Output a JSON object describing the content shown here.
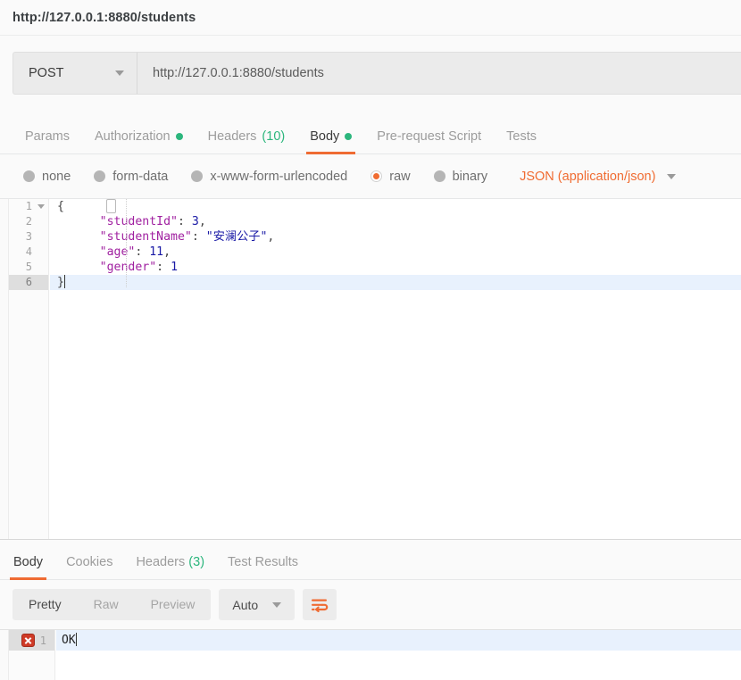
{
  "window": {
    "title": "http://127.0.0.1:8880/students"
  },
  "request": {
    "method": "POST",
    "method_caret": "chevron-down-icon",
    "url": "http://127.0.0.1:8880/students",
    "tabs": [
      {
        "label": "Params",
        "active": false,
        "indicator": "",
        "count": ""
      },
      {
        "label": "Authorization",
        "active": false,
        "indicator": "dot",
        "count": ""
      },
      {
        "label": "Headers",
        "active": false,
        "indicator": "",
        "count": "(10)"
      },
      {
        "label": "Body",
        "active": true,
        "indicator": "dot",
        "count": ""
      },
      {
        "label": "Pre-request Script",
        "active": false,
        "indicator": "",
        "count": ""
      },
      {
        "label": "Tests",
        "active": false,
        "indicator": "",
        "count": ""
      }
    ],
    "body_types": [
      {
        "label": "none",
        "selected": false
      },
      {
        "label": "form-data",
        "selected": false
      },
      {
        "label": "x-www-form-urlencoded",
        "selected": false
      },
      {
        "label": "raw",
        "selected": true
      },
      {
        "label": "binary",
        "selected": false
      }
    ],
    "content_type": "JSON (application/json)"
  },
  "editor": {
    "lines": [
      {
        "no": "1",
        "foldable": true,
        "active": false
      },
      {
        "no": "2",
        "foldable": false,
        "active": false
      },
      {
        "no": "3",
        "foldable": false,
        "active": false
      },
      {
        "no": "4",
        "foldable": false,
        "active": false
      },
      {
        "no": "5",
        "foldable": false,
        "active": false
      },
      {
        "no": "6",
        "foldable": false,
        "active": true
      }
    ],
    "code": {
      "line1": "{",
      "line2_key": "\"studentId\"",
      "line2_rest": ": ",
      "line2_val": "3",
      "line2_tail": ",",
      "line3_key": "\"studentName\"",
      "line3_rest": ": ",
      "line3_val": "\"安澜公子\"",
      "line3_tail": ",",
      "line4_key": "\"age\"",
      "line4_rest": ": ",
      "line4_val": "11",
      "line4_tail": ",",
      "line5_key": "\"gender\"",
      "line5_rest": ": ",
      "line5_val": "1",
      "line5_tail": "",
      "line6": "}"
    }
  },
  "response": {
    "tabs": [
      {
        "label": "Body",
        "active": true,
        "count": ""
      },
      {
        "label": "Cookies",
        "active": false,
        "count": ""
      },
      {
        "label": "Headers",
        "active": false,
        "count": "(3)"
      },
      {
        "label": "Test Results",
        "active": false,
        "count": ""
      }
    ],
    "view_modes": [
      {
        "label": "Pretty",
        "active": true
      },
      {
        "label": "Raw",
        "active": false
      },
      {
        "label": "Preview",
        "active": false
      }
    ],
    "format": "Auto",
    "wrap_icon": "word-wrap-icon",
    "body_line_no": "1",
    "body_text": "OK",
    "error_icon": "error-x-icon"
  },
  "colors": {
    "accent": "#ef6b33",
    "green": "#2cb67d",
    "error": "#cf3a26",
    "active_line": "#e8f1fd"
  }
}
